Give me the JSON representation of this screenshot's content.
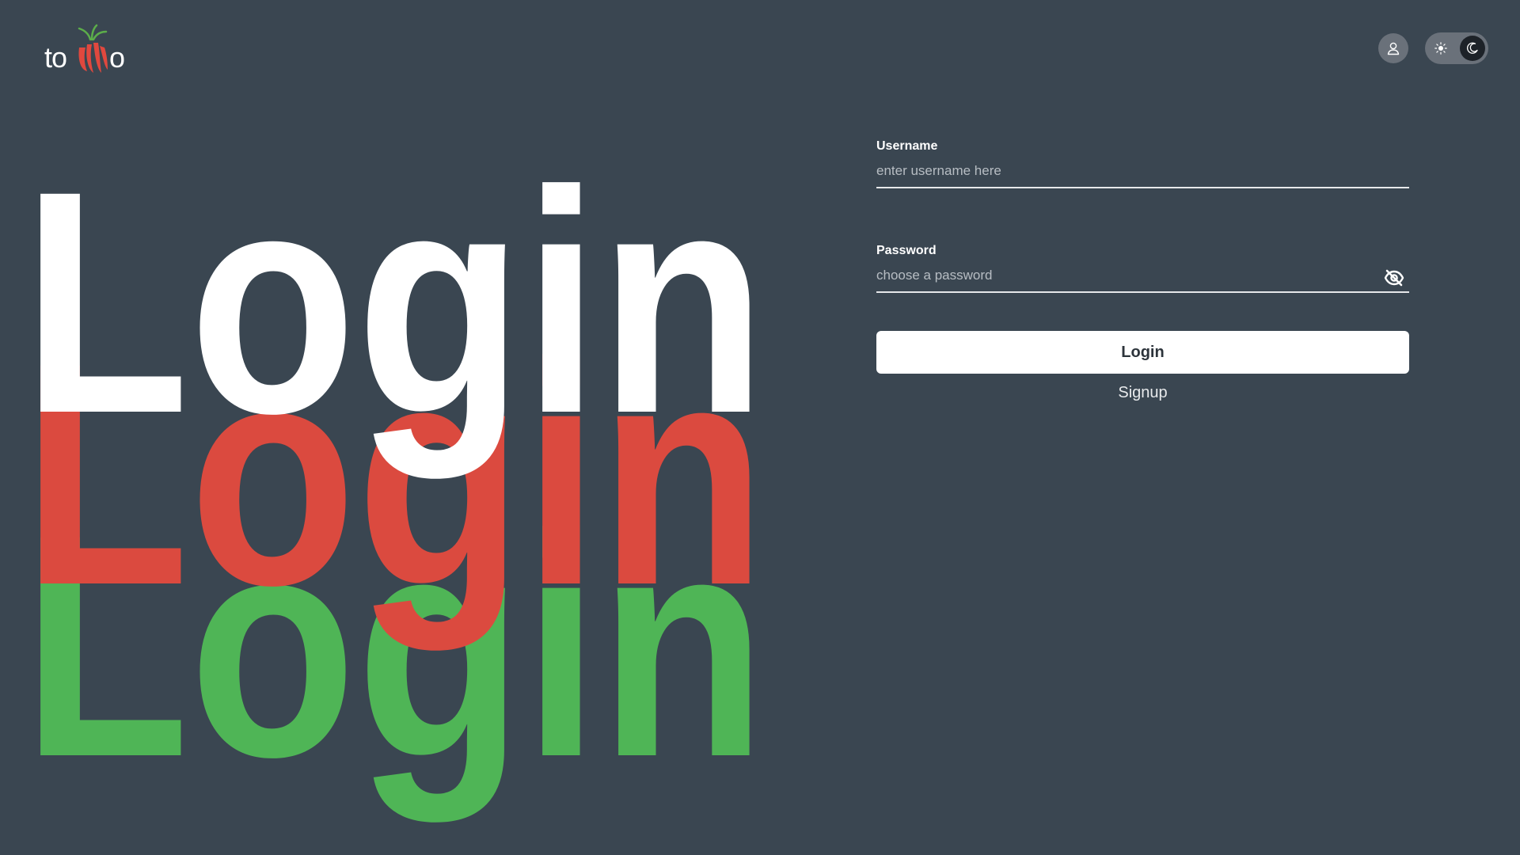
{
  "brand": {
    "logo_left": "to",
    "logo_right": "o",
    "colors": {
      "tomato": "#e0483e",
      "leaf": "#5cad4a",
      "background": "#3a4651"
    }
  },
  "header": {
    "user_icon": "user-icon",
    "theme_toggle": {
      "light_icon": "sun-icon",
      "dark_icon": "moon-icon",
      "selected": "dark"
    }
  },
  "hero": {
    "word": "Login",
    "colors": [
      "#ffffff",
      "#db4a3f",
      "#4fb556"
    ]
  },
  "form": {
    "username_label": "Username",
    "username_placeholder": "enter username here",
    "username_value": "",
    "password_label": "Password",
    "password_placeholder": "choose a password",
    "password_value": "",
    "password_toggle_icon": "eye-off-icon",
    "login_label": "Login",
    "signup_label": "Signup"
  }
}
